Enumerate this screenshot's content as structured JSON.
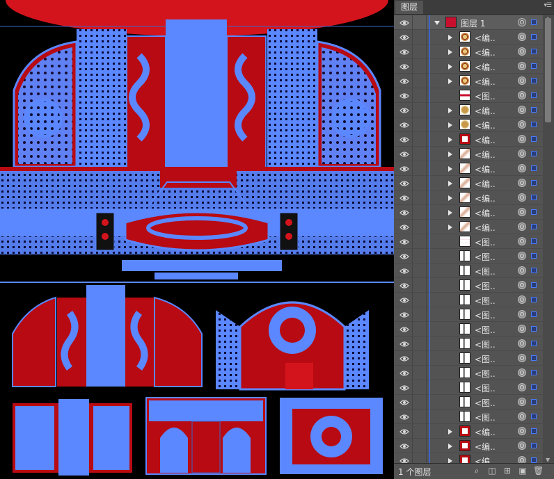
{
  "panel": {
    "tab_label": "图层",
    "menu_icon": "panel-menu-icon",
    "footer": {
      "layer_count": "1 个图层",
      "icons": [
        "locate-object-icon",
        "make-clipping-mask-icon",
        "create-sublayer-icon",
        "new-layer-icon",
        "delete-icon"
      ]
    }
  },
  "layers": [
    {
      "name": "图层 1",
      "kind": "layer",
      "expanded": true,
      "thumb": "red-ornament"
    },
    {
      "name": "<编..",
      "kind": "group",
      "thumb": "medallion"
    },
    {
      "name": "<编..",
      "kind": "group",
      "thumb": "medallion"
    },
    {
      "name": "<编..",
      "kind": "group",
      "thumb": "medallion"
    },
    {
      "name": "<编..",
      "kind": "group",
      "thumb": "medallion"
    },
    {
      "name": "<图..",
      "kind": "image",
      "thumb": "red-strip"
    },
    {
      "name": "<编..",
      "kind": "group",
      "thumb": "gold-medallion"
    },
    {
      "name": "<编..",
      "kind": "group",
      "thumb": "gold-medallion"
    },
    {
      "name": "<编..",
      "kind": "group",
      "thumb": "red-frame"
    },
    {
      "name": "<编..",
      "kind": "group",
      "thumb": "swirl"
    },
    {
      "name": "<编..",
      "kind": "group",
      "thumb": "swirl"
    },
    {
      "name": "<编..",
      "kind": "group",
      "thumb": "swirl"
    },
    {
      "name": "<编..",
      "kind": "group",
      "thumb": "swirl"
    },
    {
      "name": "<编..",
      "kind": "group",
      "thumb": "swirl"
    },
    {
      "name": "<编..",
      "kind": "group",
      "thumb": "swirl"
    },
    {
      "name": "<图..",
      "kind": "image",
      "thumb": "lines"
    },
    {
      "name": "<图..",
      "kind": "image",
      "thumb": "pillar"
    },
    {
      "name": "<图..",
      "kind": "image",
      "thumb": "pillar"
    },
    {
      "name": "<图..",
      "kind": "image",
      "thumb": "pillar"
    },
    {
      "name": "<图..",
      "kind": "image",
      "thumb": "pillar"
    },
    {
      "name": "<图..",
      "kind": "image",
      "thumb": "pillar"
    },
    {
      "name": "<图..",
      "kind": "image",
      "thumb": "pillar"
    },
    {
      "name": "<图..",
      "kind": "image",
      "thumb": "pillar"
    },
    {
      "name": "<图..",
      "kind": "image",
      "thumb": "pillar"
    },
    {
      "name": "<图..",
      "kind": "image",
      "thumb": "pillar"
    },
    {
      "name": "<图..",
      "kind": "image",
      "thumb": "pillar"
    },
    {
      "name": "<图..",
      "kind": "image",
      "thumb": "pillar"
    },
    {
      "name": "<图..",
      "kind": "image",
      "thumb": "pillar"
    },
    {
      "name": "<编..",
      "kind": "group",
      "thumb": "red-frame"
    },
    {
      "name": "<编..",
      "kind": "group",
      "thumb": "red-frame"
    },
    {
      "name": "<编..",
      "kind": "group",
      "thumb": "red-frame"
    },
    {
      "name": "<图..",
      "kind": "image",
      "thumb": "red-strip"
    }
  ],
  "colors": {
    "selection_blue": "#5b87ff",
    "ornament_red": "#b80a12",
    "lantern_red": "#d4141c",
    "panel_bg": "#535353",
    "canvas_bg": "#000000"
  }
}
